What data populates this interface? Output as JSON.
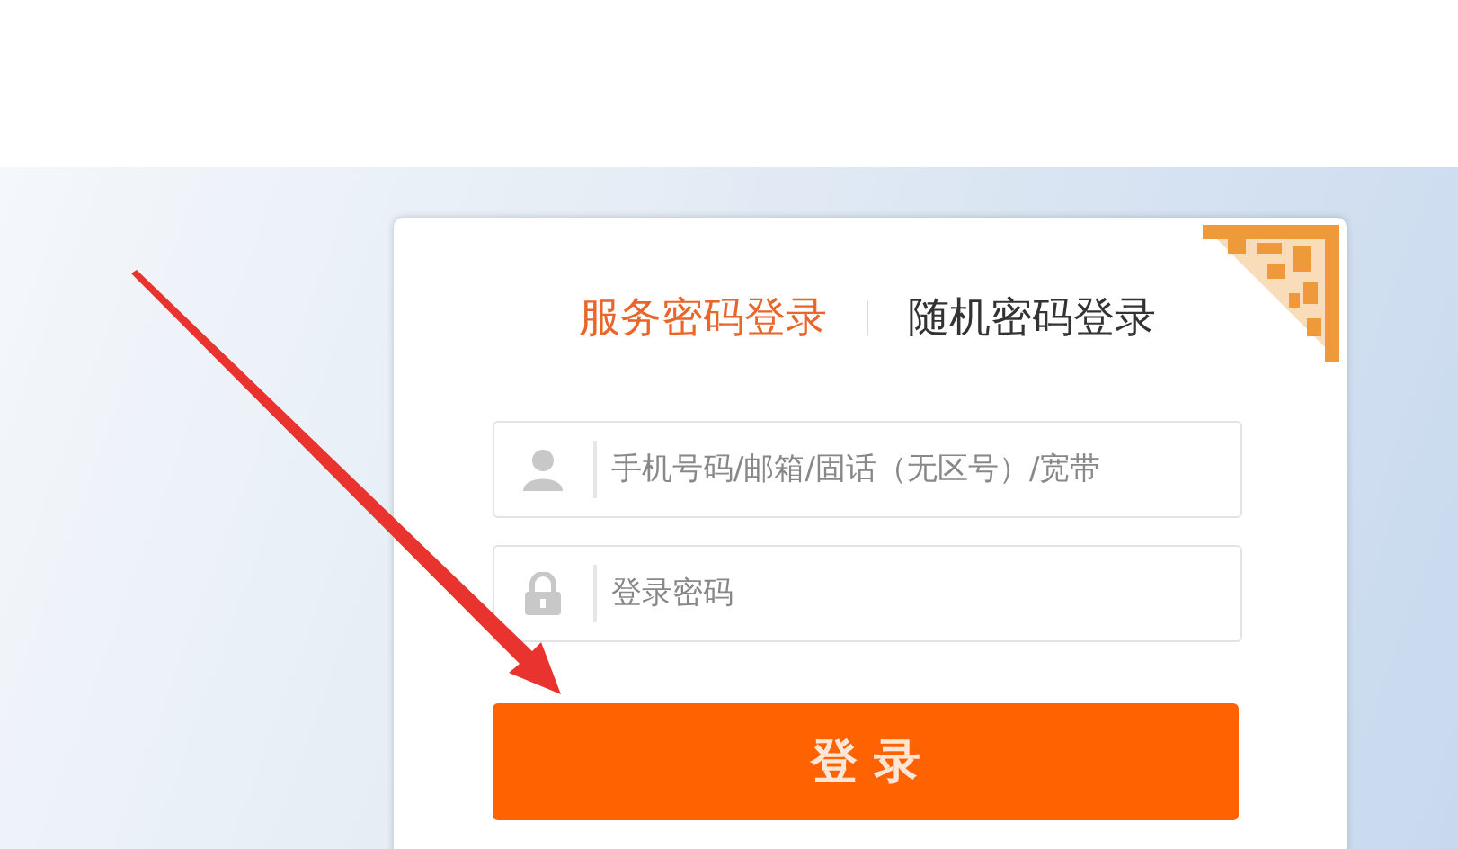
{
  "tabs": [
    {
      "label": "服务密码登录",
      "selected": true
    },
    {
      "label": "随机密码登录",
      "selected": false
    }
  ],
  "fields": [
    {
      "kind": "user",
      "placeholder": "手机号码/邮箱/固话（无区号）/宽带"
    },
    {
      "kind": "password",
      "placeholder": "登录密码"
    }
  ],
  "login_button": "登 录"
}
